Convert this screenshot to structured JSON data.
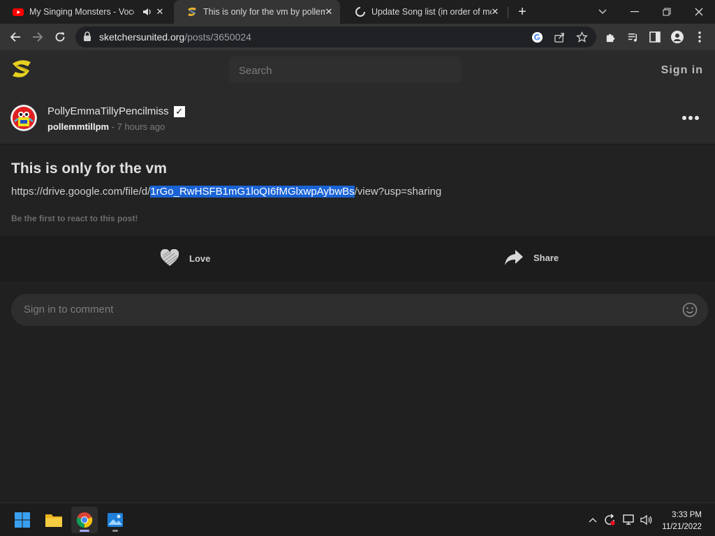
{
  "browser": {
    "tabs": [
      {
        "title": "My Singing Monsters - Voco",
        "icon": "youtube-icon",
        "audio": true
      },
      {
        "title": "This is only for the vm by pollemm",
        "icon": "sketchers-united-icon",
        "active": true
      },
      {
        "title": "Update Song list (in order of mo",
        "icon": "loading-spinner-icon"
      }
    ],
    "url_host": "sketchersunited.org",
    "url_path": "/posts/3650024"
  },
  "site": {
    "search_placeholder": "Search",
    "sign_in": "Sign in"
  },
  "post": {
    "author": "PollyEmmaTillyPencilmiss",
    "verified_mark": "✓",
    "handle": "pollemmtillpm",
    "time": " - 7 hours ago",
    "title": "This is only for the vm",
    "link_prefix": "https://drive.google.com/file/d/",
    "link_selected": "1rGo_RwHSFB1mG1loQI6fMGlxwpAybwBs",
    "link_suffix": "/view?usp=sharing",
    "react_note": "Be the first to react to this post!",
    "love_label": "Love",
    "share_label": "Share",
    "comment_placeholder": "Sign in to comment"
  },
  "taskbar": {
    "apps": [
      "windows-start-icon",
      "file-explorer-icon",
      "chrome-icon",
      "photos-icon"
    ],
    "time": "3:33 PM",
    "date": "11/21/2022"
  },
  "colors": {
    "selection": "#1a63d6",
    "logo_yellow": "#e6d020",
    "page_bg": "#202020"
  }
}
